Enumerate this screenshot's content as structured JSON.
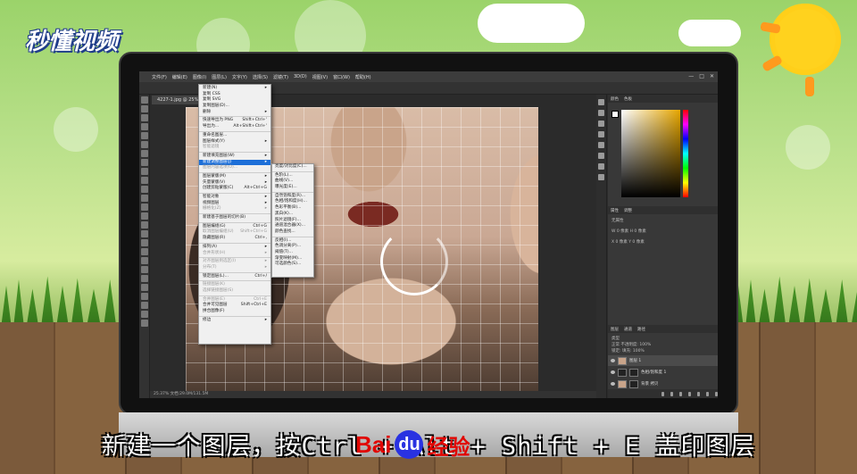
{
  "brand": {
    "logo_text": "秒懂视频"
  },
  "photoshop": {
    "menubar": [
      "文件(F)",
      "编辑(E)",
      "图像(I)",
      "图层(L)",
      "文字(Y)",
      "选择(S)",
      "滤镜(T)",
      "3D(D)",
      "视图(V)",
      "窗口(W)",
      "帮助(H)"
    ],
    "document_tab": "4227-1.jpg @ 25% (图层 1, RGB/8) *",
    "status": "25.37%    文档:29.0M/131.5M",
    "layer_menu": [
      {
        "label": "新建(N)",
        "arrow": true
      },
      {
        "label": "复制 CSS"
      },
      {
        "label": "复制 SVG"
      },
      {
        "label": "复制图层(D)..."
      },
      {
        "label": "删除",
        "arrow": true
      },
      {
        "sep": true
      },
      {
        "label": "快速导出为 PNG",
        "shortcut": "Shift+Ctrl+'"
      },
      {
        "label": "导出为...",
        "shortcut": "Alt+Shift+Ctrl+'"
      },
      {
        "sep": true
      },
      {
        "label": "重命名图层..."
      },
      {
        "label": "图层样式(Y)",
        "arrow": true
      },
      {
        "label": "智能滤镜",
        "disabled": true
      },
      {
        "sep": true
      },
      {
        "label": "新建填充图层(W)",
        "arrow": true
      },
      {
        "label": "新建调整图层(J)",
        "arrow": true,
        "highlight": true
      },
      {
        "label": "图层内容选项(O)...",
        "disabled": true
      },
      {
        "sep": true
      },
      {
        "label": "图层蒙版(M)",
        "arrow": true
      },
      {
        "label": "矢量蒙版(V)",
        "arrow": true
      },
      {
        "label": "创建剪贴蒙版(C)",
        "shortcut": "Alt+Ctrl+G"
      },
      {
        "sep": true
      },
      {
        "label": "智能对象",
        "arrow": true
      },
      {
        "label": "视频图层",
        "arrow": true
      },
      {
        "label": "栅格化(Z)",
        "arrow": true,
        "disabled": true
      },
      {
        "sep": true
      },
      {
        "label": "新建基于图层的切片(B)"
      },
      {
        "sep": true
      },
      {
        "label": "图层编组(G)",
        "shortcut": "Ctrl+G"
      },
      {
        "label": "取消图层编组(U)",
        "shortcut": "Shift+Ctrl+G",
        "disabled": true
      },
      {
        "label": "隐藏图层(R)",
        "shortcut": "Ctrl+,"
      },
      {
        "sep": true
      },
      {
        "label": "排列(A)",
        "arrow": true
      },
      {
        "label": "合并形状(H)",
        "arrow": true,
        "disabled": true
      },
      {
        "sep": true
      },
      {
        "label": "对齐图层到选区(I)",
        "arrow": true,
        "disabled": true
      },
      {
        "label": "分布(T)",
        "arrow": true,
        "disabled": true
      },
      {
        "sep": true
      },
      {
        "label": "锁定图层(L)...",
        "shortcut": "Ctrl+/"
      },
      {
        "sep": true
      },
      {
        "label": "链接图层(K)",
        "disabled": true
      },
      {
        "label": "选择链接图层(S)",
        "disabled": true
      },
      {
        "sep": true
      },
      {
        "label": "合并图层(E)",
        "shortcut": "Ctrl+E",
        "disabled": true
      },
      {
        "label": "合并可见图层",
        "shortcut": "Shift+Ctrl+E"
      },
      {
        "label": "拼合图像(F)"
      },
      {
        "sep": true
      },
      {
        "label": "修边",
        "arrow": true
      }
    ],
    "adjust_submenu": [
      "亮度/对比度(C)...",
      "色阶(L)...",
      "曲线(V)...",
      "曝光度(E)...",
      "自然饱和度(R)...",
      "色相/饱和度(H)...",
      "色彩平衡(B)...",
      "黑白(K)...",
      "照片滤镜(F)...",
      "通道混合器(X)...",
      "颜色查找...",
      "反相(I)...",
      "色调分离(P)...",
      "阈值(T)...",
      "渐变映射(M)...",
      "可选颜色(S)..."
    ],
    "panels": {
      "color_tabs": [
        "颜色",
        "色板"
      ],
      "props_tabs": [
        "属性",
        "调整"
      ],
      "props_rows": [
        "无属性",
        "W 0 像素  H 0 像素",
        "X 0 像素  Y 0 像素"
      ],
      "layers_tabs": [
        "图层",
        "通道",
        "路径"
      ],
      "layer_opts": [
        "类型",
        "正常    不透明度: 100%",
        "锁定:    填充: 100%"
      ],
      "layers": [
        {
          "name": "图层 1",
          "selected": true
        },
        {
          "name": "色相/饱和度 1",
          "adj": true
        },
        {
          "name": "背景 拷贝",
          "mask": true
        },
        {
          "name": "背景"
        }
      ]
    }
  },
  "subtitle": "新建一个图层，按Ctrl + Alt + Shift + E 盖印图层",
  "watermark": {
    "bai": "Bai",
    "paw": "du",
    "jingyan": "经验"
  }
}
